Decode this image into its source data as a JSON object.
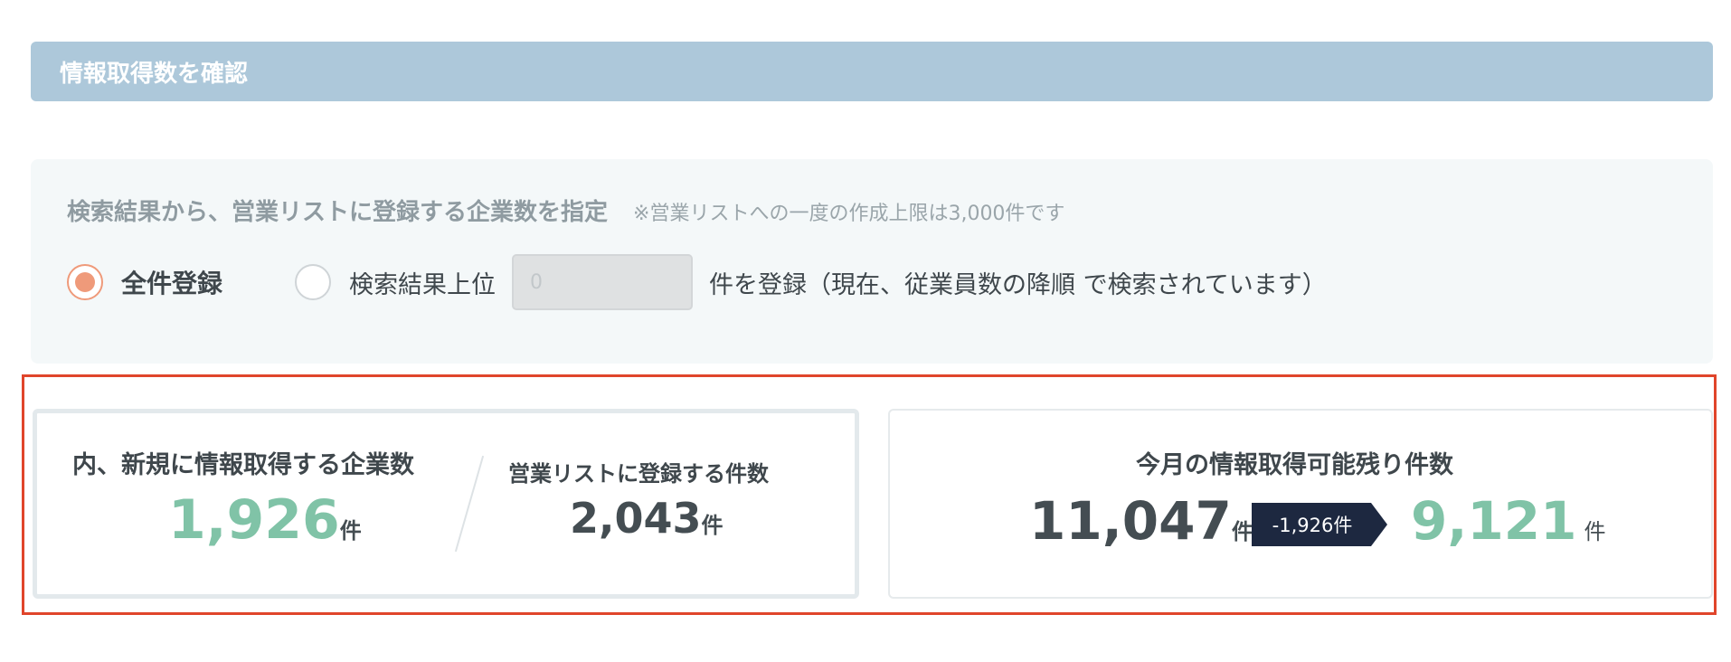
{
  "header": {
    "title": "情報取得数を確認"
  },
  "spec": {
    "title": "検索結果から、営業リストに登録する企業数を指定",
    "note": "※営業リストへの一度の作成上限は3,000件です",
    "option_all_label": "全件登録",
    "option_top_label": "検索結果上位",
    "input_placeholder": "0",
    "suffix_text": "件を登録（現在、従業員数の降順 で検索されています）"
  },
  "summary": {
    "new_label": "内、新規に情報取得する企業数",
    "new_value": "1,926",
    "register_label": "営業リストに登録する件数",
    "register_value": "2,043",
    "unit": "件",
    "remaining_label": "今月の情報取得可能残り件数",
    "remaining_before": "11,047",
    "remaining_delta": "-1,926件",
    "remaining_after": "9,121"
  },
  "colors": {
    "header_bg": "#adc8da",
    "radio_accent": "#ef9a7a",
    "highlight_border": "#e0452b",
    "positive_green": "#80c3a7",
    "badge_navy": "#1d2840"
  }
}
